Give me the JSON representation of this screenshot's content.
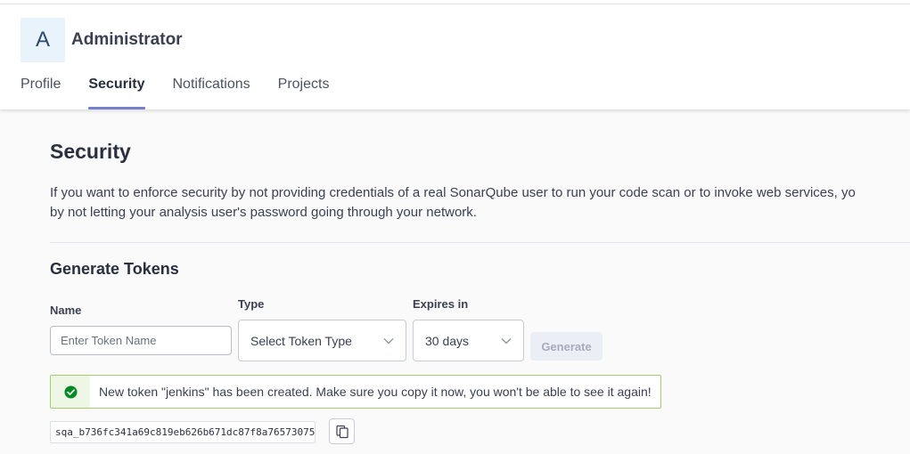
{
  "user": {
    "avatar_letter": "A",
    "name": "Administrator"
  },
  "tabs": [
    {
      "label": "Profile",
      "active": false
    },
    {
      "label": "Security",
      "active": true
    },
    {
      "label": "Notifications",
      "active": false
    },
    {
      "label": "Projects",
      "active": false
    }
  ],
  "security": {
    "title": "Security",
    "description_line1": "If you want to enforce security by not providing credentials of a real SonarQube user to run your code scan or to invoke web services, yo",
    "description_line2": "by not letting your analysis user's password going through your network."
  },
  "generate": {
    "title": "Generate Tokens",
    "name_label": "Name",
    "name_placeholder": "Enter Token Name",
    "type_label": "Type",
    "type_value": "Select Token Type",
    "expires_label": "Expires in",
    "expires_value": "30 days",
    "button_label": "Generate"
  },
  "alert": {
    "icon": "check-circle-icon",
    "message": "New token \"jenkins\" has been created. Make sure you copy it now, you won't be able to see it again!"
  },
  "token": {
    "value": "sqa_b736fc341a69c819eb626b671dc87f8a76573075",
    "copy_icon": "copy-icon"
  },
  "colors": {
    "accent": "#7480c9",
    "success_border": "#a3cf6b",
    "success_icon": "#008a25",
    "avatar_bg": "#e8f3fb"
  }
}
